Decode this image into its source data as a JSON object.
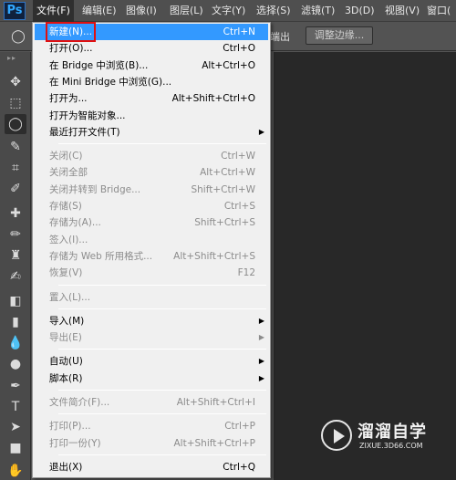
{
  "app": {
    "logo": "Ps"
  },
  "menubar": [
    {
      "label": "文件(F)",
      "active": true
    },
    {
      "label": "编辑(E)"
    },
    {
      "label": "图像(I)"
    },
    {
      "label": "图层(L)"
    },
    {
      "label": "文字(Y)"
    },
    {
      "label": "选择(S)"
    },
    {
      "label": "滤镜(T)"
    },
    {
      "label": "3D(D)"
    },
    {
      "label": "视图(V)"
    },
    {
      "label": "窗口("
    }
  ],
  "options_bar": {
    "partial_label": "端出",
    "refine_edge_button": "调整边缘..."
  },
  "toolbox": {
    "grip": "▸▸",
    "tools": [
      {
        "icon": "move-tool-icon",
        "glyph": "✥"
      },
      {
        "icon": "rectangular-marquee-icon",
        "glyph": "⬚"
      },
      {
        "icon": "lasso-icon",
        "glyph": "◯",
        "selected": true
      },
      {
        "icon": "quick-selection-icon",
        "glyph": "✎"
      },
      {
        "icon": "crop-icon",
        "glyph": "⌗"
      },
      {
        "icon": "eyedropper-icon",
        "glyph": "✐"
      },
      {
        "icon": "spot-healing-icon",
        "glyph": "✚"
      },
      {
        "icon": "brush-icon",
        "glyph": "✏"
      },
      {
        "icon": "clone-stamp-icon",
        "glyph": "♜"
      },
      {
        "icon": "history-brush-icon",
        "glyph": "✍"
      },
      {
        "icon": "eraser-icon",
        "glyph": "◧"
      },
      {
        "icon": "gradient-icon",
        "glyph": "▮"
      },
      {
        "icon": "blur-icon",
        "glyph": "💧"
      },
      {
        "icon": "dodge-icon",
        "glyph": "●"
      },
      {
        "icon": "pen-icon",
        "glyph": "✒"
      },
      {
        "icon": "type-icon",
        "glyph": "T"
      },
      {
        "icon": "path-selection-icon",
        "glyph": "➤"
      },
      {
        "icon": "rectangle-shape-icon",
        "glyph": "■"
      },
      {
        "icon": "hand-icon",
        "glyph": "✋"
      }
    ]
  },
  "file_menu": {
    "items": [
      {
        "type": "item",
        "label": "新建(N)...",
        "shortcut": "Ctrl+N",
        "highlighted": true
      },
      {
        "type": "item",
        "label": "打开(O)...",
        "shortcut": "Ctrl+O"
      },
      {
        "type": "item",
        "label": "在 Bridge 中浏览(B)...",
        "shortcut": "Alt+Ctrl+O"
      },
      {
        "type": "item",
        "label": "在 Mini Bridge 中浏览(G)...",
        "shortcut": ""
      },
      {
        "type": "item",
        "label": "打开为...",
        "shortcut": "Alt+Shift+Ctrl+O"
      },
      {
        "type": "item",
        "label": "打开为智能对象...",
        "shortcut": ""
      },
      {
        "type": "item",
        "label": "最近打开文件(T)",
        "shortcut": "",
        "submenu": true
      },
      {
        "type": "sep"
      },
      {
        "type": "item",
        "label": "关闭(C)",
        "shortcut": "Ctrl+W",
        "disabled": true
      },
      {
        "type": "item",
        "label": "关闭全部",
        "shortcut": "Alt+Ctrl+W",
        "disabled": true
      },
      {
        "type": "item",
        "label": "关闭并转到 Bridge...",
        "shortcut": "Shift+Ctrl+W",
        "disabled": true
      },
      {
        "type": "item",
        "label": "存储(S)",
        "shortcut": "Ctrl+S",
        "disabled": true
      },
      {
        "type": "item",
        "label": "存储为(A)...",
        "shortcut": "Shift+Ctrl+S",
        "disabled": true
      },
      {
        "type": "item",
        "label": "签入(I)...",
        "shortcut": "",
        "disabled": true
      },
      {
        "type": "item",
        "label": "存储为 Web 所用格式...",
        "shortcut": "Alt+Shift+Ctrl+S",
        "disabled": true
      },
      {
        "type": "item",
        "label": "恢复(V)",
        "shortcut": "F12",
        "disabled": true
      },
      {
        "type": "sep"
      },
      {
        "type": "item",
        "label": "置入(L)...",
        "shortcut": "",
        "disabled": true
      },
      {
        "type": "sep"
      },
      {
        "type": "item",
        "label": "导入(M)",
        "shortcut": "",
        "submenu": true
      },
      {
        "type": "item",
        "label": "导出(E)",
        "shortcut": "",
        "submenu": true,
        "disabled": true
      },
      {
        "type": "sep"
      },
      {
        "type": "item",
        "label": "自动(U)",
        "shortcut": "",
        "submenu": true
      },
      {
        "type": "item",
        "label": "脚本(R)",
        "shortcut": "",
        "submenu": true
      },
      {
        "type": "sep"
      },
      {
        "type": "item",
        "label": "文件简介(F)...",
        "shortcut": "Alt+Shift+Ctrl+I",
        "disabled": true
      },
      {
        "type": "sep"
      },
      {
        "type": "item",
        "label": "打印(P)...",
        "shortcut": "Ctrl+P",
        "disabled": true
      },
      {
        "type": "item",
        "label": "打印一份(Y)",
        "shortcut": "Alt+Shift+Ctrl+P",
        "disabled": true
      },
      {
        "type": "sep"
      },
      {
        "type": "item",
        "label": "退出(X)",
        "shortcut": "Ctrl+Q"
      }
    ]
  },
  "watermark": {
    "title": "溜溜自学",
    "url": "ZIXUE.3D66.COM"
  },
  "colors": {
    "highlight": "#3399ff",
    "highlight_border": "#e01010",
    "menu_bg": "#f0f0f0",
    "app_bg": "#535353",
    "canvas_bg": "#282828"
  }
}
